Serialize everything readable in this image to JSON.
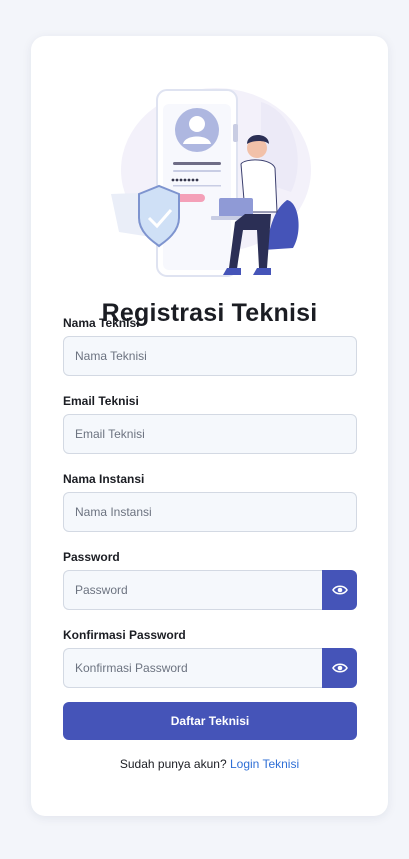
{
  "form": {
    "title": "Registrasi Teknisi",
    "fields": {
      "nama": {
        "label": "Nama Teknisi",
        "placeholder": "Nama Teknisi",
        "value": ""
      },
      "email": {
        "label": "Email Teknisi",
        "placeholder": "Email Teknisi",
        "value": ""
      },
      "instansi": {
        "label": "Nama Instansi",
        "placeholder": "Nama Instansi",
        "value": ""
      },
      "password": {
        "label": "Password",
        "placeholder": "Password",
        "value": ""
      },
      "konfirmasi": {
        "label": "Konfirmasi Password",
        "placeholder": "Konfirmasi Password",
        "value": ""
      }
    },
    "submit_label": "Daftar Teknisi",
    "login_prompt": "Sudah punya akun?",
    "login_link": "Login Teknisi"
  },
  "icons": {
    "toggle": "eye-icon",
    "illustration": "registration-illustration"
  },
  "colors": {
    "primary": "#4554b8",
    "link": "#2f6fd6",
    "page_bg": "#f3f5fa",
    "card_bg": "#ffffff",
    "input_bg": "#f5f8fc",
    "input_border": "#d3d9e3"
  }
}
